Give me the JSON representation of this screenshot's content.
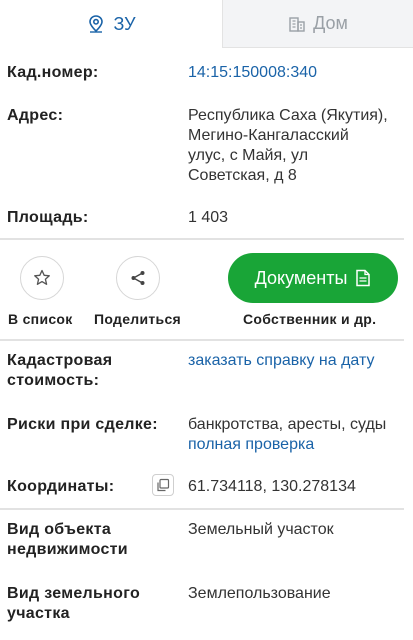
{
  "tabs": [
    {
      "label": "ЗУ",
      "active": true
    },
    {
      "label": "Дом",
      "active": false
    }
  ],
  "fields": {
    "cad_number": {
      "label": "Кад.номер:",
      "value": "14:15:150008:340"
    },
    "address": {
      "label": "Адрес:",
      "lines": [
        "Республика Саха (Якутия),",
        "Мегино-Кангаласский",
        "улус, с Майя, ул",
        "Советская, д 8"
      ]
    },
    "area": {
      "label": "Площадь:",
      "value": "1 403"
    }
  },
  "actions": {
    "add_to_list": "В список",
    "share": "Поделиться",
    "documents": "Документы",
    "owner": "Собственник и др."
  },
  "details": {
    "cad_cost": {
      "label_lines": [
        "Кадастровая",
        "стоимость:"
      ],
      "link": "заказать справку на дату"
    },
    "risks": {
      "label": "Риски при сделке:",
      "value": "банкротства, аресты, суды",
      "link": "полная проверка"
    },
    "coords": {
      "label": "Координаты:",
      "value": "61.734118, 130.278134"
    },
    "object_type": {
      "label_lines": [
        "Вид объекта",
        "недвижимости"
      ],
      "value": "Земельный участок"
    },
    "land_type": {
      "label_lines": [
        "Вид земельного",
        "участка"
      ],
      "value": "Землепользование"
    }
  },
  "colors": {
    "accent": "#1a63a8",
    "button_green": "#19a537"
  }
}
